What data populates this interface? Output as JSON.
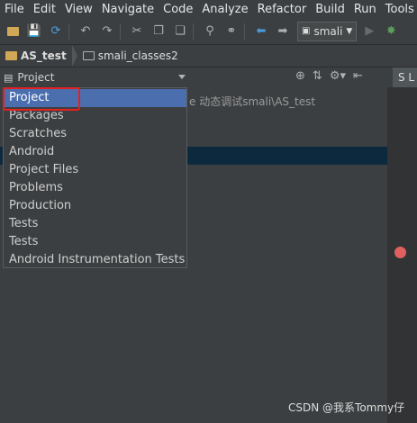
{
  "menu": [
    "File",
    "Edit",
    "View",
    "Navigate",
    "Code",
    "Analyze",
    "Refactor",
    "Build",
    "Run",
    "Tools"
  ],
  "toolbar": {
    "run_config_label": "smali",
    "icons": [
      "open-folder-icon",
      "save-icon",
      "sync-icon",
      "undo-icon",
      "redo-icon",
      "cut-icon",
      "copy-icon",
      "paste-icon",
      "find-icon",
      "replace-icon",
      "back-icon",
      "forward-icon",
      "run-config-icon",
      "run-icon",
      "debug-icon"
    ]
  },
  "breadcrumbs": [
    "AS_test",
    "smali_classes2"
  ],
  "project_panel": {
    "view_selector": "Project",
    "path_fragment": "e  动态调试smali\\AS_test"
  },
  "dropdown": {
    "items": [
      "Project",
      "Packages",
      "Scratches",
      "Android",
      "Project Files",
      "Problems",
      "Production",
      "Tests",
      "Tests",
      "Android Instrumentation Tests"
    ],
    "selected_index": 0
  },
  "editor": {
    "tab_label": "S L"
  },
  "watermark": "CSDN @我系Tommy仔",
  "colors": {
    "highlight_box": "#e52020",
    "selection": "#4b6eaf",
    "breakpoint": "#e06060"
  }
}
